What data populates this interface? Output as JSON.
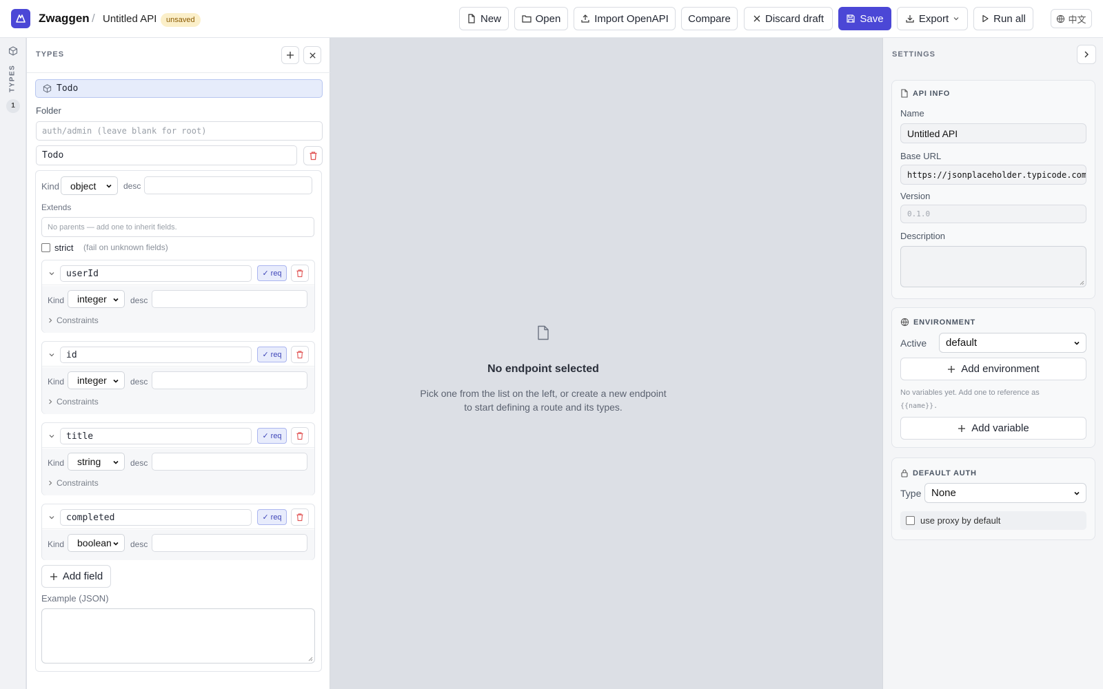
{
  "header": {
    "brand": "Zwaggen",
    "separator": "/",
    "api_name": "Untitled API",
    "status_badge": "unsaved",
    "buttons": {
      "new": "New",
      "open": "Open",
      "import": "Import OpenAPI",
      "compare": "Compare",
      "discard": "Discard draft",
      "save": "Save",
      "export": "Export",
      "run_all": "Run all",
      "language": "中文"
    }
  },
  "rail": {
    "label": "TYPES",
    "count": "1"
  },
  "types_panel": {
    "title": "TYPES",
    "selected_type": "Todo",
    "folder_label": "Folder",
    "folder_placeholder": "auth/admin (leave blank for root)",
    "type_name": "Todo",
    "kind_label": "Kind",
    "kind_value": "object",
    "desc_label": "desc",
    "extends_label": "Extends",
    "extends_placeholder": "No parents — add one to inherit fields.",
    "strict_label": "strict",
    "strict_hint": "(fail on unknown fields)",
    "req_label": "req",
    "constraints_label": "Constraints",
    "fields": [
      {
        "name": "userId",
        "kind": "integer"
      },
      {
        "name": "id",
        "kind": "integer"
      },
      {
        "name": "title",
        "kind": "string"
      },
      {
        "name": "completed",
        "kind": "boolean"
      }
    ],
    "add_field": "Add field",
    "example_label": "Example (JSON)"
  },
  "center": {
    "empty_title": "No endpoint selected",
    "empty_line1": "Pick one from the list on the left, or create a new endpoint",
    "empty_line2": "to start defining a route and its types."
  },
  "settings": {
    "title": "SETTINGS",
    "api_info": {
      "title": "API INFO",
      "name_label": "Name",
      "name_value": "Untitled API",
      "base_url_label": "Base URL",
      "base_url_value": "https://jsonplaceholder.typicode.com",
      "version_label": "Version",
      "version_placeholder": "0.1.0",
      "description_label": "Description"
    },
    "environment": {
      "title": "ENVIRONMENT",
      "active_label": "Active",
      "active_value": "default",
      "add_environment": "Add environment",
      "note_line1": "No variables yet. Add one to reference as",
      "note_line2": "{{name}}.",
      "add_variable": "Add variable"
    },
    "default_auth": {
      "title": "DEFAULT AUTH",
      "type_label": "Type",
      "type_value": "None",
      "proxy_label": "use proxy by default"
    }
  },
  "colors": {
    "accent": "#4b47d6",
    "danger": "#e05252",
    "badge_bg": "#fbefc9"
  }
}
